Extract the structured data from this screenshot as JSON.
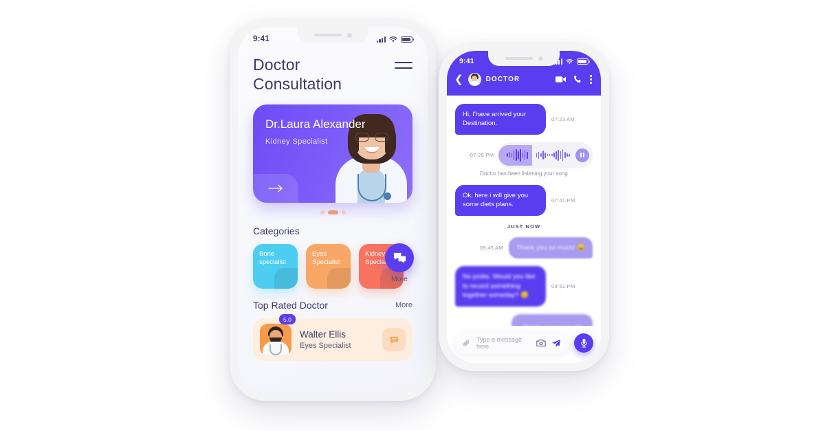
{
  "left_phone": {
    "status_bar": {
      "time": "9:41",
      "signal_icon": "signal-bars-icon",
      "wifi_icon": "wifi-icon",
      "battery_icon": "battery-icon"
    },
    "header": {
      "title": "Doctor Consultation",
      "menu_icon": "hamburger-menu-icon"
    },
    "featured_card": {
      "doctor_name": "Dr.Laura Alexander",
      "specialty": "Kidney Specialist",
      "arrow_icon": "arrow-right-icon",
      "gradient_start": "#6d4bf6",
      "gradient_end": "#8f6ff9"
    },
    "carousel": {
      "dot_count": 3,
      "active_index": 1,
      "active_color": "#f7a765",
      "inactive_color": "#fbd9bd"
    },
    "more_fab": {
      "label": "More",
      "icon": "chat-bubbles-icon",
      "color": "#5b3df0"
    },
    "categories_section": {
      "title": "Categories",
      "items": [
        {
          "label": "Bone specialist",
          "color": "#4ecdf2"
        },
        {
          "label": "Eyes Specialist",
          "color": "#f9a766"
        },
        {
          "label": "Kidney Specialist",
          "color": "#f87360"
        }
      ]
    },
    "top_rated_section": {
      "title": "Top Rated Doctor",
      "more_label": "More",
      "doctor": {
        "name": "Walter Ellis",
        "specialty": "Eyes Specialist",
        "rating": "5.0",
        "chat_icon": "chat-bubble-icon",
        "card_color": "#fdeee0"
      }
    }
  },
  "right_phone": {
    "status_bar": {
      "time": "9:41",
      "signal_icon": "signal-bars-icon",
      "wifi_icon": "wifi-icon",
      "battery_icon": "battery-icon"
    },
    "chat_header": {
      "back_icon": "chevron-left-icon",
      "avatar": "doctor-avatar",
      "title": "DOCTOR",
      "video_icon": "video-camera-icon",
      "call_icon": "phone-icon",
      "menu_icon": "kebab-menu-icon",
      "background_color": "#5b3df0"
    },
    "messages": [
      {
        "text": "Hi, I'have arrived your Destination.",
        "time": "07:23 AM",
        "side": "in",
        "blurred": false
      },
      {
        "type": "voice",
        "time": "07:28 PM",
        "caption": "Doctor has been listening your song",
        "pause_icon": "pause-icon",
        "side": "out"
      },
      {
        "text": "Ok, here i will give you some diets plans.",
        "time": "07:41 PM",
        "side": "in",
        "blurred": false
      },
      {
        "divider": "JUST NOW"
      },
      {
        "text": "Thank you so much! 😀",
        "time": "09:45 AM",
        "side": "out",
        "blurred": true
      },
      {
        "text": "No probs. Would you like to record something together someday? 😊",
        "time": "09:51 PM",
        "side": "in",
        "blurred": true
      },
      {
        "text": "Thank you so much!",
        "time": "",
        "side": "out",
        "blurred": true
      }
    ],
    "composer": {
      "attach_icon": "paperclip-icon",
      "placeholder": "Type a message here",
      "camera_icon": "camera-icon",
      "send_icon": "send-paper-plane-icon",
      "mic_icon": "microphone-icon",
      "mic_color": "#5b3df0"
    }
  }
}
